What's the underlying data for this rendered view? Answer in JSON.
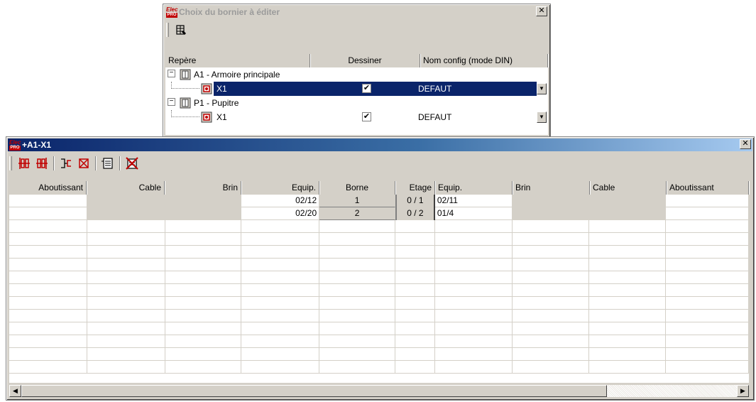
{
  "dialog": {
    "title": "Choix du bornier à éditer",
    "columns": [
      "Repère",
      "Dessiner",
      "Nom config (mode DIN)"
    ],
    "rows": [
      {
        "type": "group",
        "label": "A1 - Armoire principale",
        "expanded": true
      },
      {
        "type": "item",
        "label": "X1",
        "dessiner": true,
        "config": "DEFAUT",
        "selected": true
      },
      {
        "type": "group",
        "label": "P1 - Pupitre",
        "expanded": true
      },
      {
        "type": "item",
        "label": "X1",
        "dessiner": true,
        "config": "DEFAUT",
        "selected": false
      }
    ],
    "expander_glyph": "−",
    "dropdown_glyph": "▼",
    "selection_color": "#0a246a"
  },
  "editor": {
    "title": "+A1-X1",
    "columns": [
      "Aboutissant",
      "Cable",
      "Brin",
      "Equip.",
      "Borne",
      "Etage",
      "Equip.",
      "Brin",
      "Cable",
      "Aboutissant"
    ],
    "rows": [
      {
        "equip_left": "02/12",
        "borne": "1",
        "etage": "0 / 1",
        "equip_right": "02/11"
      },
      {
        "equip_left": "02/20",
        "borne": "2",
        "etage": "0 / 2",
        "equip_right": "01/4"
      }
    ],
    "toolbar_icons": [
      "terminal-strip-icon",
      "terminal-strip-red-icon",
      "bridge-icon",
      "delete-terminal-icon",
      "document-list-icon",
      "delete-list-icon"
    ]
  },
  "app_badge": {
    "top": "Elec",
    "bottom": "PRO"
  },
  "window_close_glyph": "✕",
  "scroll_left_glyph": "◀",
  "scroll_right_glyph": "▶"
}
